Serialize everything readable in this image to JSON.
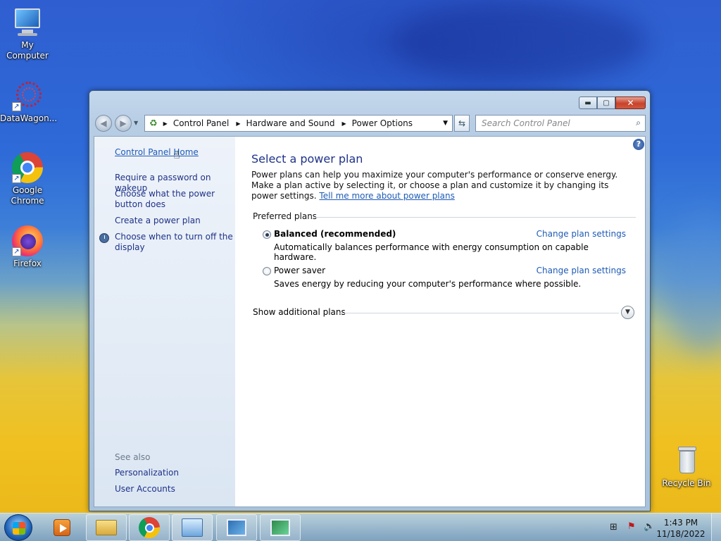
{
  "desktop": {
    "icons": [
      {
        "label": "My Computer"
      },
      {
        "label": "DataWagon..."
      },
      {
        "label": "Google Chrome"
      },
      {
        "label": "Firefox"
      },
      {
        "label": "Recycle Bin"
      }
    ]
  },
  "window": {
    "address": {
      "crumbs": [
        "Control Panel",
        "Hardware and Sound",
        "Power Options"
      ]
    },
    "search": {
      "placeholder": "Search Control Panel"
    },
    "left_pane": {
      "home": "Control Panel Home",
      "links": [
        "Require a password on wakeup",
        "Choose what the power button does",
        "Create a power plan",
        "Choose when to turn off the display"
      ],
      "see_also_label": "See also",
      "see_also": [
        "Personalization",
        "User Accounts"
      ]
    },
    "main": {
      "title": "Select a power plan",
      "description": "Power plans can help you maximize your computer's performance or conserve energy. Make a plan active by selecting it, or choose a plan and customize it by changing its power settings.",
      "tell_more": "Tell me more about power plans",
      "preferred_label": "Preferred plans",
      "plans": [
        {
          "name": "Balanced (recommended)",
          "description": "Automatically balances performance with energy consumption on capable hardware.",
          "change": "Change plan settings",
          "selected": true
        },
        {
          "name": "Power saver",
          "description": "Saves energy by reducing your computer's performance where possible.",
          "change": "Change plan settings",
          "selected": false
        }
      ],
      "show_more": "Show additional plans"
    }
  },
  "taskbar": {
    "time": "1:43 PM",
    "date": "11/18/2022"
  }
}
